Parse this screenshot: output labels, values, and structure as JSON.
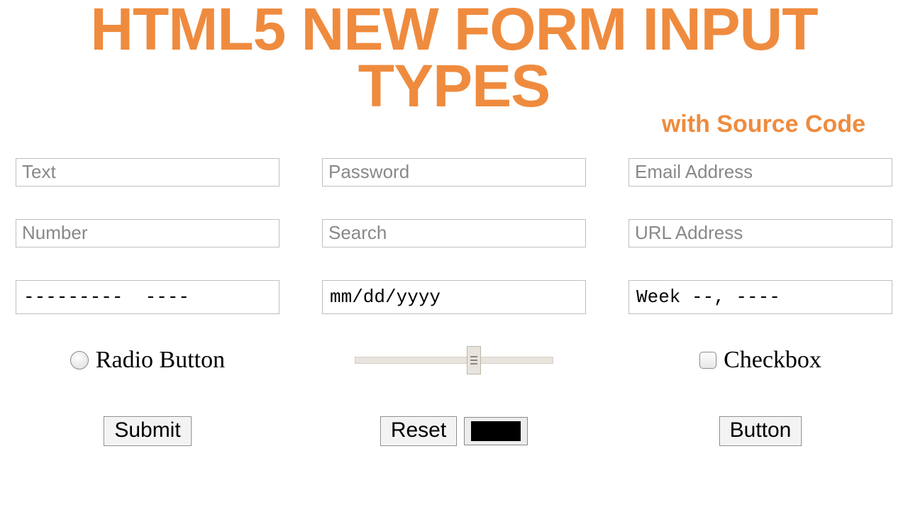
{
  "header": {
    "title": "HTML5 NEW FORM INPUT TYPES",
    "subtitle": "with Source Code"
  },
  "inputs": {
    "row1": {
      "text": "Text",
      "password": "Password",
      "email": "Email Address"
    },
    "row2": {
      "number": "Number",
      "search": "Search",
      "url": "URL Address"
    },
    "row3": {
      "month": "---------  ----",
      "date": "mm/dd/yyyy",
      "week": "Week --, ----"
    }
  },
  "controls": {
    "radio_label": "Radio Button",
    "checkbox_label": "Checkbox"
  },
  "buttons": {
    "submit": "Submit",
    "reset": "Reset",
    "button": "Button"
  },
  "color": {
    "value": "#000000"
  }
}
